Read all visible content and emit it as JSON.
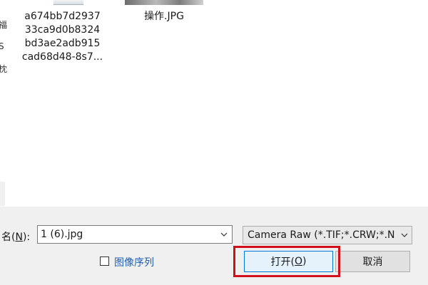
{
  "files": {
    "items": [
      {
        "name_lines": [
          "a674bb7d2937",
          "33ca9d0b8324",
          "bd3ae2adb915",
          "cad68d48-8s7..."
        ]
      },
      {
        "name": "操作.JPG"
      }
    ],
    "left_edge_chars": [
      "福",
      "S",
      "枕"
    ]
  },
  "footer": {
    "filename_label_prefix": "名(",
    "filename_label_key": "N",
    "filename_label_suffix": "):",
    "filename_value": "1 (6).jpg",
    "filetype_value": "Camera Raw (*.TIF;*.CRW;*.N",
    "sequence_label": "图像序列",
    "open_label_prefix": "打开(",
    "open_label_key": "O",
    "open_label_suffix": ")",
    "cancel_label": "取消"
  },
  "icons": {
    "dropdown": "chevron-down-icon"
  },
  "colors": {
    "highlight": "#d0101c",
    "link": "#1e5fb4",
    "footer_bg": "#f0f0f0"
  }
}
